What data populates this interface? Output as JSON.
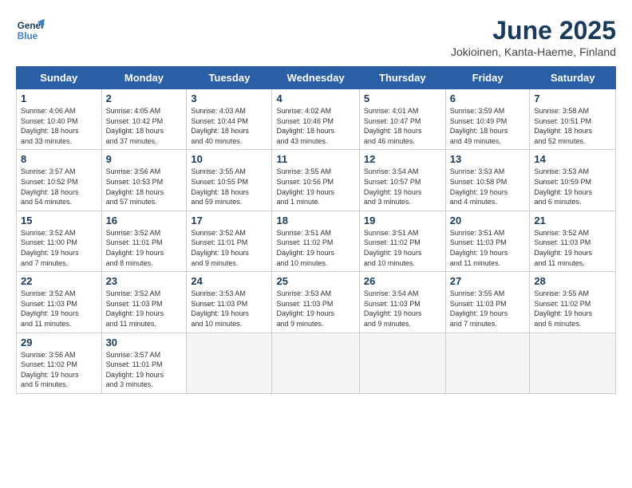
{
  "logo": {
    "line1": "General",
    "line2": "Blue"
  },
  "title": "June 2025",
  "location": "Jokioinen, Kanta-Haeme, Finland",
  "days_of_week": [
    "Sunday",
    "Monday",
    "Tuesday",
    "Wednesday",
    "Thursday",
    "Friday",
    "Saturday"
  ],
  "weeks": [
    [
      {
        "day": "1",
        "info": "Sunrise: 4:06 AM\nSunset: 10:40 PM\nDaylight: 18 hours\nand 33 minutes."
      },
      {
        "day": "2",
        "info": "Sunrise: 4:05 AM\nSunset: 10:42 PM\nDaylight: 18 hours\nand 37 minutes."
      },
      {
        "day": "3",
        "info": "Sunrise: 4:03 AM\nSunset: 10:44 PM\nDaylight: 18 hours\nand 40 minutes."
      },
      {
        "day": "4",
        "info": "Sunrise: 4:02 AM\nSunset: 10:46 PM\nDaylight: 18 hours\nand 43 minutes."
      },
      {
        "day": "5",
        "info": "Sunrise: 4:01 AM\nSunset: 10:47 PM\nDaylight: 18 hours\nand 46 minutes."
      },
      {
        "day": "6",
        "info": "Sunrise: 3:59 AM\nSunset: 10:49 PM\nDaylight: 18 hours\nand 49 minutes."
      },
      {
        "day": "7",
        "info": "Sunrise: 3:58 AM\nSunset: 10:51 PM\nDaylight: 18 hours\nand 52 minutes."
      }
    ],
    [
      {
        "day": "8",
        "info": "Sunrise: 3:57 AM\nSunset: 10:52 PM\nDaylight: 18 hours\nand 54 minutes."
      },
      {
        "day": "9",
        "info": "Sunrise: 3:56 AM\nSunset: 10:53 PM\nDaylight: 18 hours\nand 57 minutes."
      },
      {
        "day": "10",
        "info": "Sunrise: 3:55 AM\nSunset: 10:55 PM\nDaylight: 18 hours\nand 59 minutes."
      },
      {
        "day": "11",
        "info": "Sunrise: 3:55 AM\nSunset: 10:56 PM\nDaylight: 19 hours\nand 1 minute."
      },
      {
        "day": "12",
        "info": "Sunrise: 3:54 AM\nSunset: 10:57 PM\nDaylight: 19 hours\nand 3 minutes."
      },
      {
        "day": "13",
        "info": "Sunrise: 3:53 AM\nSunset: 10:58 PM\nDaylight: 19 hours\nand 4 minutes."
      },
      {
        "day": "14",
        "info": "Sunrise: 3:53 AM\nSunset: 10:59 PM\nDaylight: 19 hours\nand 6 minutes."
      }
    ],
    [
      {
        "day": "15",
        "info": "Sunrise: 3:52 AM\nSunset: 11:00 PM\nDaylight: 19 hours\nand 7 minutes."
      },
      {
        "day": "16",
        "info": "Sunrise: 3:52 AM\nSunset: 11:01 PM\nDaylight: 19 hours\nand 8 minutes."
      },
      {
        "day": "17",
        "info": "Sunrise: 3:52 AM\nSunset: 11:01 PM\nDaylight: 19 hours\nand 9 minutes."
      },
      {
        "day": "18",
        "info": "Sunrise: 3:51 AM\nSunset: 11:02 PM\nDaylight: 19 hours\nand 10 minutes."
      },
      {
        "day": "19",
        "info": "Sunrise: 3:51 AM\nSunset: 11:02 PM\nDaylight: 19 hours\nand 10 minutes."
      },
      {
        "day": "20",
        "info": "Sunrise: 3:51 AM\nSunset: 11:03 PM\nDaylight: 19 hours\nand 11 minutes."
      },
      {
        "day": "21",
        "info": "Sunrise: 3:52 AM\nSunset: 11:03 PM\nDaylight: 19 hours\nand 11 minutes."
      }
    ],
    [
      {
        "day": "22",
        "info": "Sunrise: 3:52 AM\nSunset: 11:03 PM\nDaylight: 19 hours\nand 11 minutes."
      },
      {
        "day": "23",
        "info": "Sunrise: 3:52 AM\nSunset: 11:03 PM\nDaylight: 19 hours\nand 11 minutes."
      },
      {
        "day": "24",
        "info": "Sunrise: 3:53 AM\nSunset: 11:03 PM\nDaylight: 19 hours\nand 10 minutes."
      },
      {
        "day": "25",
        "info": "Sunrise: 3:53 AM\nSunset: 11:03 PM\nDaylight: 19 hours\nand 9 minutes."
      },
      {
        "day": "26",
        "info": "Sunrise: 3:54 AM\nSunset: 11:03 PM\nDaylight: 19 hours\nand 9 minutes."
      },
      {
        "day": "27",
        "info": "Sunrise: 3:55 AM\nSunset: 11:03 PM\nDaylight: 19 hours\nand 7 minutes."
      },
      {
        "day": "28",
        "info": "Sunrise: 3:55 AM\nSunset: 11:02 PM\nDaylight: 19 hours\nand 6 minutes."
      }
    ],
    [
      {
        "day": "29",
        "info": "Sunrise: 3:56 AM\nSunset: 11:02 PM\nDaylight: 19 hours\nand 5 minutes."
      },
      {
        "day": "30",
        "info": "Sunrise: 3:57 AM\nSunset: 11:01 PM\nDaylight: 19 hours\nand 3 minutes."
      },
      {
        "day": "",
        "info": ""
      },
      {
        "day": "",
        "info": ""
      },
      {
        "day": "",
        "info": ""
      },
      {
        "day": "",
        "info": ""
      },
      {
        "day": "",
        "info": ""
      }
    ]
  ]
}
